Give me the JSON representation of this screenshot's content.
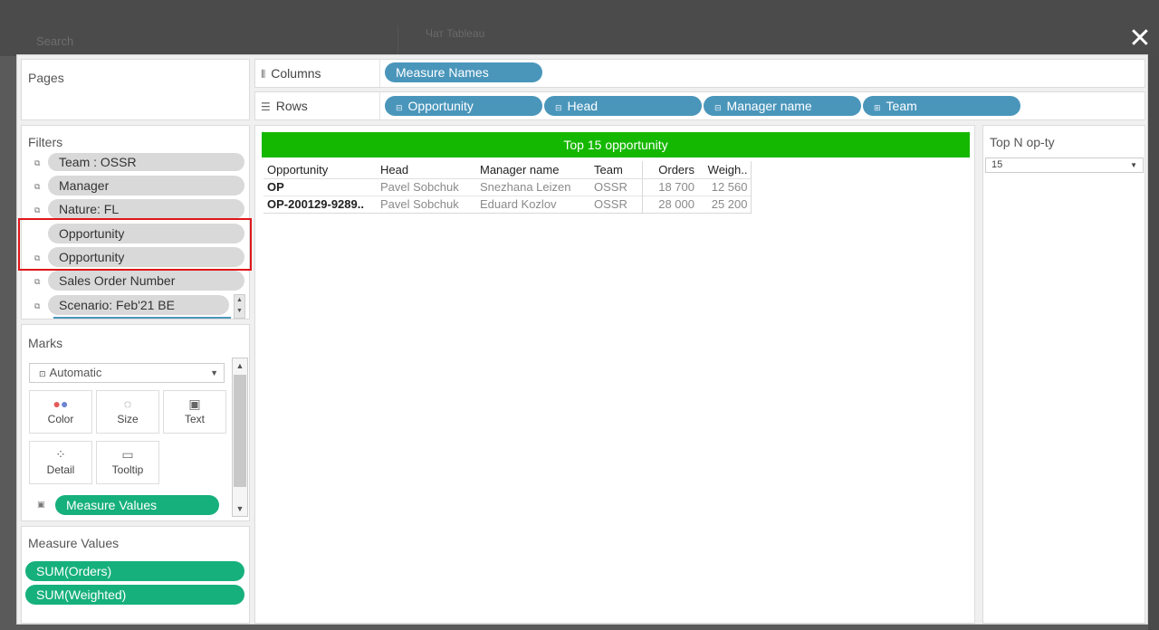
{
  "background": {
    "search_placeholder": "Search",
    "title": "Чат Tableau"
  },
  "modal": {
    "close_glyph": "✕",
    "pages": {
      "title": "Pages"
    },
    "shelves": {
      "columns_label": "Columns",
      "rows_label": "Rows",
      "columns_pills": [
        "Measure Names"
      ],
      "rows_pills": [
        "Opportunity",
        "Head",
        "Manager name",
        "Team"
      ]
    },
    "filters": {
      "title": "Filters",
      "items": [
        "Team : OSSR",
        "Manager",
        "Nature: FL",
        "Opportunity",
        "Opportunity",
        "Sales Order Number",
        "Scenario: Feb'21 BE"
      ]
    },
    "marks": {
      "title": "Marks",
      "mark_type": "Automatic",
      "buttons": [
        "Color",
        "Size",
        "Text",
        "Detail",
        "Tooltip"
      ],
      "pill": "Measure Values"
    },
    "measure_values": {
      "title": "Measure Values",
      "pills": [
        "SUM(Orders)",
        "SUM(Weighted)"
      ]
    },
    "viz": {
      "title": "Top 15 opportunity",
      "headers": [
        "Opportunity",
        "Head",
        "Manager name",
        "Team",
        "Orders",
        "Weigh.."
      ],
      "rows": [
        [
          "OP",
          "Pavel Sobchuk",
          "Snezhana Leizen",
          "OSSR",
          "18 700",
          "12 560"
        ],
        [
          "OP-200129-9289..",
          "Pavel Sobchuk",
          "Eduard Kozlov",
          "OSSR",
          "28 000",
          "25 200"
        ]
      ]
    },
    "parameter": {
      "title": "Top N op-ty",
      "value": "15"
    }
  },
  "colors": {
    "title_bar": "#15b800",
    "dimension_pill": "#4a96bb",
    "measure_pill": "#16b07c",
    "highlight_box": "#e0161b"
  }
}
